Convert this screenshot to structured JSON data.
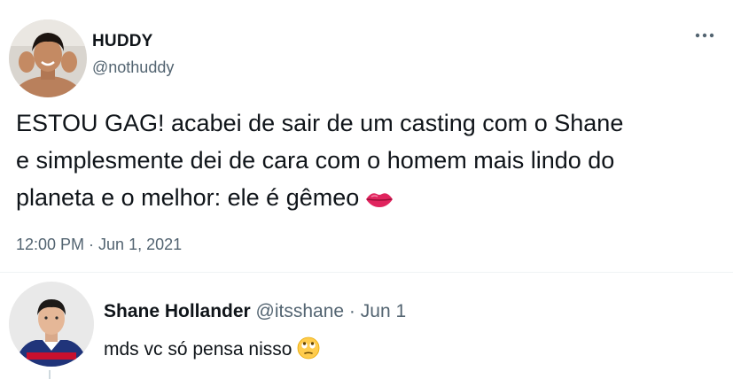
{
  "tweet": {
    "display_name": "HUDDY",
    "handle": "@nothuddy",
    "text_lines": [
      "ESTOU GAG! acabei de sair de um casting com o Shane",
      "e simplesmente dei de cara com o homem mais lindo do",
      "planeta e o melhor: ele é gêmeo"
    ],
    "text_emoji": "lips-emoji",
    "timestamp": "12:00 PM · Jun 1, 2021",
    "more_icon": "more-horizontal-icon"
  },
  "reply": {
    "display_name": "Shane Hollander",
    "handle": "@itsshane",
    "separator": " · ",
    "date": "Jun 1",
    "text": "mds vc só pensa nisso",
    "text_emoji": "face-with-rolling-eyes-emoji"
  },
  "colors": {
    "text_primary": "#0f1419",
    "text_secondary": "#536471",
    "divider": "#eff3f4"
  }
}
